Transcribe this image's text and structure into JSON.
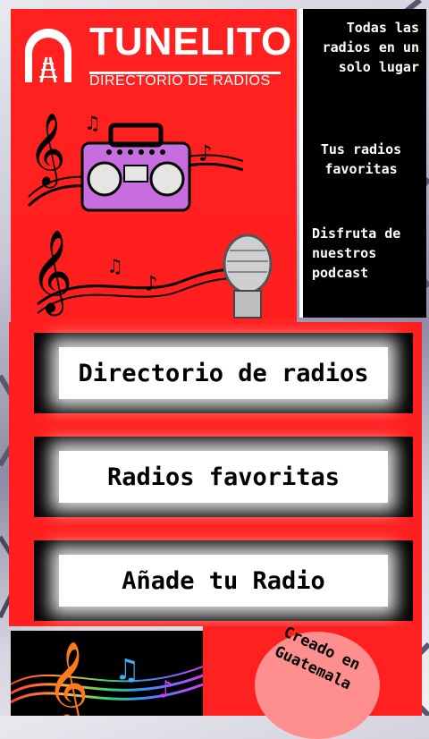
{
  "logo": {
    "title": "TUNELITO",
    "subtitle": "DIRECTORIO DE RADIOS"
  },
  "side_panel": {
    "line1": "Todas las radios en un solo lugar",
    "line2": "Tus radios favoritas",
    "line3": "Disfruta de nuestros podcast"
  },
  "menu": {
    "buttons": [
      {
        "label": "Directorio de radios"
      },
      {
        "label": "Radios favoritas"
      },
      {
        "label": "Añade tu Radio"
      }
    ]
  },
  "footer": {
    "badge_text": "Creado en Guatemala"
  },
  "icons": {
    "logo": "tunnel-rails-icon",
    "boombox": "boombox-icon",
    "microphone": "microphone-icon",
    "music_notes": "music-notes-icon"
  },
  "colors": {
    "brand_red": "#ff1f1f",
    "panel_black": "#000000",
    "button_white": "#ffffff"
  }
}
